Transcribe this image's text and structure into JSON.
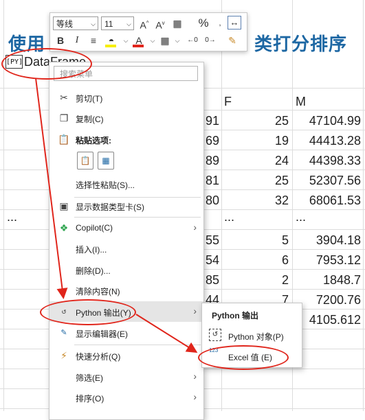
{
  "sheet": {
    "heading_left": "使用",
    "heading_right": "类打分排序",
    "cell_label": "DataFrame",
    "cell_badge": "[PY]",
    "col_f": "F",
    "col_m": "M",
    "partial_col": [
      "91",
      "69",
      "89",
      "81",
      "80",
      "",
      "55",
      "54",
      "85",
      "44"
    ],
    "col_f_values": [
      "25",
      "19",
      "24",
      "25",
      "32",
      "...",
      "5",
      "6",
      "2",
      "7"
    ],
    "col_m_values": [
      "47104.99",
      "44413.28",
      "44398.33",
      "52307.56",
      "68061.53",
      "...",
      "3904.18",
      "7953.12",
      "1848.7",
      "7200.76",
      "4105.612"
    ],
    "ellipsis_left": "..."
  },
  "minibar": {
    "font_name": "等线",
    "font_size": "11",
    "grow_font": "A",
    "shrink_font": "A",
    "percent": "%",
    "bold": "B",
    "italic": "I",
    "font_color_letter": "A"
  },
  "context_menu": {
    "search_placeholder": "搜索菜单",
    "cut": "剪切(T)",
    "copy": "复制(C)",
    "paste_options": "粘贴选项:",
    "paste_special": "选择性粘贴(S)...",
    "show_card": "显示数据类型卡(S)",
    "copilot": "Copilot(C)",
    "insert": "插入(I)...",
    "delete": "删除(D)...",
    "clear": "清除内容(N)",
    "python_output": "Python 输出(Y)",
    "show_editor": "显示编辑器(E)",
    "quick_analysis": "快速分析(Q)",
    "filter": "筛选(E)",
    "sort": "排序(O)"
  },
  "submenu": {
    "title": "Python 输出",
    "python_object": "Python 对象(P)",
    "excel_value": "Excel 值 (E)",
    "excel_value_badge": "123"
  },
  "colors": {
    "heading": "#1d67a3",
    "annotation": "#e0251b"
  }
}
